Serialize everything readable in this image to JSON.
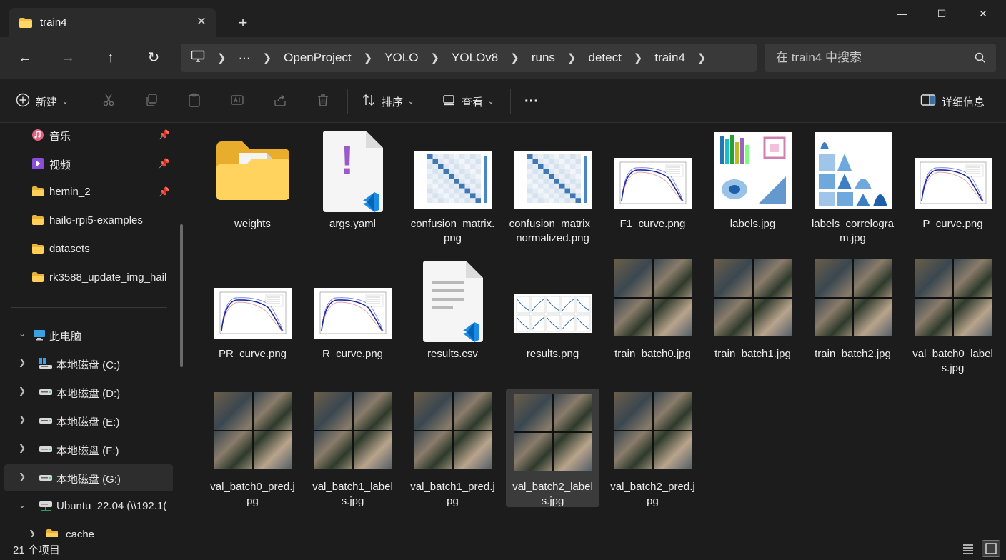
{
  "tab": {
    "title": "train4",
    "close_icon": "close-icon",
    "new_tab": "+"
  },
  "window_controls": {
    "minimize": "—",
    "maximize": "☐",
    "close": "✕"
  },
  "nav": {
    "back": "←",
    "forward": "→",
    "up": "↑",
    "refresh": "↻"
  },
  "breadcrumbs": [
    {
      "label": "OpenProject"
    },
    {
      "label": "YOLO"
    },
    {
      "label": "YOLOv8"
    },
    {
      "label": "runs"
    },
    {
      "label": "detect"
    },
    {
      "label": "train4"
    }
  ],
  "breadcrumb_overflow": "···",
  "search": {
    "placeholder": "在 train4 中搜索"
  },
  "commands": {
    "new_label": "新建",
    "sort_label": "排序",
    "view_label": "查看",
    "more": "···",
    "details_label": "详细信息"
  },
  "sidebar": {
    "quick_access": [
      {
        "label": "音乐",
        "icon": "music-icon",
        "pinned": true
      },
      {
        "label": "视频",
        "icon": "video-icon",
        "pinned": true
      },
      {
        "label": "hemin_2",
        "icon": "folder-icon",
        "pinned": true
      },
      {
        "label": "hailo-rpi5-examples",
        "icon": "folder-icon",
        "pinned": false
      },
      {
        "label": "datasets",
        "icon": "folder-icon",
        "pinned": false
      },
      {
        "label": "rk3588_update_img_hail",
        "icon": "folder-icon",
        "pinned": false
      }
    ],
    "this_pc": {
      "label": "此电脑",
      "icon": "monitor-icon"
    },
    "drives": [
      {
        "label": "本地磁盘 (C:)",
        "icon": "windows-drive-icon"
      },
      {
        "label": "本地磁盘 (D:)",
        "icon": "drive-icon"
      },
      {
        "label": "本地磁盘 (E:)",
        "icon": "drive-icon"
      },
      {
        "label": "本地磁盘 (F:)",
        "icon": "drive-icon"
      },
      {
        "label": "本地磁盘 (G:)",
        "icon": "drive-icon"
      },
      {
        "label": "Ubuntu_22.04 (\\\\192.1(",
        "icon": "network-drive-icon"
      },
      {
        "label": "cache",
        "icon": "folder-icon"
      }
    ]
  },
  "files": [
    {
      "name": "weights",
      "kind": "folder"
    },
    {
      "name": "args.yaml",
      "kind": "yaml"
    },
    {
      "name": "confusion_matrix.png",
      "kind": "matrix"
    },
    {
      "name": "confusion_matrix_normalized.png",
      "kind": "matrix"
    },
    {
      "name": "F1_curve.png",
      "kind": "curve"
    },
    {
      "name": "labels.jpg",
      "kind": "labels"
    },
    {
      "name": "labels_correlogram.jpg",
      "kind": "correlogram"
    },
    {
      "name": "P_curve.png",
      "kind": "curve"
    },
    {
      "name": "PR_curve.png",
      "kind": "curve"
    },
    {
      "name": "R_curve.png",
      "kind": "curve"
    },
    {
      "name": "results.csv",
      "kind": "csv"
    },
    {
      "name": "results.png",
      "kind": "results"
    },
    {
      "name": "train_batch0.jpg",
      "kind": "mosaic"
    },
    {
      "name": "train_batch1.jpg",
      "kind": "mosaic"
    },
    {
      "name": "train_batch2.jpg",
      "kind": "mosaic"
    },
    {
      "name": "val_batch0_labels.jpg",
      "kind": "mosaic"
    },
    {
      "name": "val_batch0_pred.jpg",
      "kind": "mosaic"
    },
    {
      "name": "val_batch1_labels.jpg",
      "kind": "mosaic"
    },
    {
      "name": "val_batch1_pred.jpg",
      "kind": "mosaic"
    },
    {
      "name": "val_batch2_labels.jpg",
      "kind": "mosaic",
      "selected": true
    },
    {
      "name": "val_batch2_pred.jpg",
      "kind": "mosaic"
    }
  ],
  "status": {
    "item_count": "21 个项目"
  }
}
